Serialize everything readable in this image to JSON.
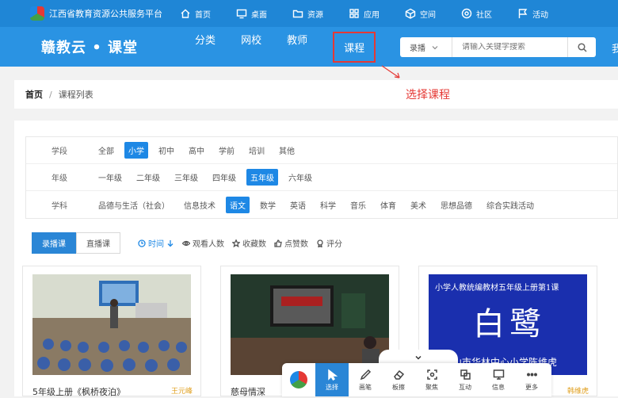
{
  "topbar": {
    "site_title": "江西省教育资源公共服务平台",
    "nav": [
      {
        "label": "首页",
        "icon": "home-icon"
      },
      {
        "label": "桌面",
        "icon": "desktop-icon"
      },
      {
        "label": "资源",
        "icon": "folder-icon"
      },
      {
        "label": "应用",
        "icon": "apps-icon"
      },
      {
        "label": "空间",
        "icon": "cube-icon"
      },
      {
        "label": "社区",
        "icon": "community-icon"
      },
      {
        "label": "活动",
        "icon": "flag-icon"
      }
    ]
  },
  "header": {
    "brand": "赣教云 • 课堂",
    "nav": [
      "分类",
      "网校",
      "教师",
      "课程"
    ],
    "selected_nav": "课程",
    "search": {
      "type": "录播",
      "placeholder": "请输入关键字搜索"
    },
    "edge_text": "我"
  },
  "breadcrumb": {
    "home": "首页",
    "separator": "/",
    "current": "课程列表"
  },
  "annotation": {
    "text": "选择课程",
    "color": "#e53935"
  },
  "filters": [
    {
      "label": "学段",
      "options": [
        "全部",
        "小学",
        "初中",
        "高中",
        "学前",
        "培训",
        "其他"
      ],
      "active": "小学"
    },
    {
      "label": "年级",
      "options": [
        "一年级",
        "二年级",
        "三年级",
        "四年级",
        "五年级",
        "六年级"
      ],
      "active": "五年级"
    },
    {
      "label": "学科",
      "options": [
        "品德与生活（社会）",
        "信息技术",
        "语文",
        "数学",
        "英语",
        "科学",
        "音乐",
        "体育",
        "美术",
        "思想品德",
        "综合实践活动"
      ],
      "active": "语文"
    }
  ],
  "tabs": [
    "录播课",
    "直播课"
  ],
  "active_tab": "录播课",
  "sorts": [
    {
      "label": "时间",
      "icon": "clock-icon",
      "active": true
    },
    {
      "label": "观看人数",
      "icon": "eye-icon",
      "active": false
    },
    {
      "label": "收藏数",
      "icon": "star-icon",
      "active": false
    },
    {
      "label": "点赞数",
      "icon": "thumb-icon",
      "active": false
    },
    {
      "label": "评分",
      "icon": "rating-icon",
      "active": false
    }
  ],
  "courses": [
    {
      "title": "5年级上册《枫桥夜泊》",
      "teacher": "王元峰"
    },
    {
      "title": "慈母情深",
      "teacher": ""
    },
    {
      "title": "",
      "teacher": "韩维虎",
      "thumb_top": "小学人教统编教材五年级上册第1课",
      "thumb_big": "白鹭",
      "thumb_bottom": "庐山市华林中心小学陈维虎"
    }
  ],
  "toolbar": {
    "items": [
      {
        "label": "选择",
        "icon": "cursor-icon",
        "active": true
      },
      {
        "label": "画笔",
        "icon": "pen-icon",
        "active": false
      },
      {
        "label": "板擦",
        "icon": "eraser-icon",
        "active": false
      },
      {
        "label": "聚焦",
        "icon": "focus-icon",
        "active": false
      },
      {
        "label": "互动",
        "icon": "interact-icon",
        "active": false
      },
      {
        "label": "信息",
        "icon": "monitor-icon",
        "active": false
      },
      {
        "label": "更多",
        "icon": "more-icon",
        "active": false
      }
    ]
  },
  "colors": {
    "topbar": "#1f86d6",
    "header": "#2a93e3",
    "accent": "#1e88e5",
    "highlight": "#e53935"
  }
}
